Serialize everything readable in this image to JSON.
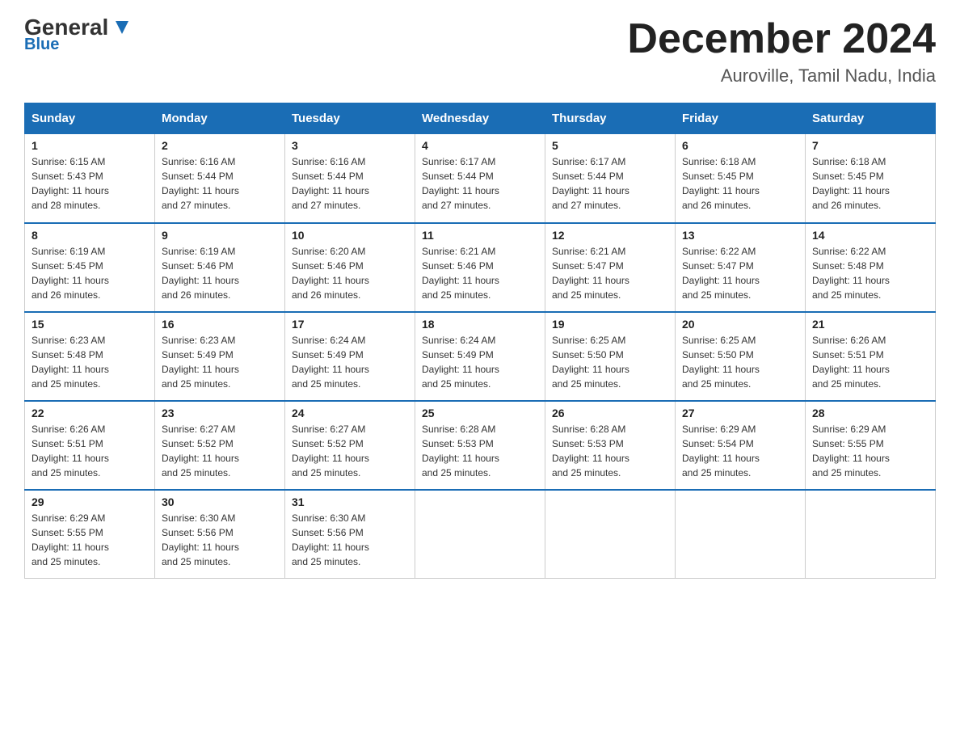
{
  "header": {
    "logo_general": "General",
    "logo_blue": "Blue",
    "month_title": "December 2024",
    "location": "Auroville, Tamil Nadu, India"
  },
  "days_of_week": [
    "Sunday",
    "Monday",
    "Tuesday",
    "Wednesday",
    "Thursday",
    "Friday",
    "Saturday"
  ],
  "weeks": [
    [
      {
        "num": "1",
        "sunrise": "6:15 AM",
        "sunset": "5:43 PM",
        "daylight": "11 hours and 28 minutes."
      },
      {
        "num": "2",
        "sunrise": "6:16 AM",
        "sunset": "5:44 PM",
        "daylight": "11 hours and 27 minutes."
      },
      {
        "num": "3",
        "sunrise": "6:16 AM",
        "sunset": "5:44 PM",
        "daylight": "11 hours and 27 minutes."
      },
      {
        "num": "4",
        "sunrise": "6:17 AM",
        "sunset": "5:44 PM",
        "daylight": "11 hours and 27 minutes."
      },
      {
        "num": "5",
        "sunrise": "6:17 AM",
        "sunset": "5:44 PM",
        "daylight": "11 hours and 27 minutes."
      },
      {
        "num": "6",
        "sunrise": "6:18 AM",
        "sunset": "5:45 PM",
        "daylight": "11 hours and 26 minutes."
      },
      {
        "num": "7",
        "sunrise": "6:18 AM",
        "sunset": "5:45 PM",
        "daylight": "11 hours and 26 minutes."
      }
    ],
    [
      {
        "num": "8",
        "sunrise": "6:19 AM",
        "sunset": "5:45 PM",
        "daylight": "11 hours and 26 minutes."
      },
      {
        "num": "9",
        "sunrise": "6:19 AM",
        "sunset": "5:46 PM",
        "daylight": "11 hours and 26 minutes."
      },
      {
        "num": "10",
        "sunrise": "6:20 AM",
        "sunset": "5:46 PM",
        "daylight": "11 hours and 26 minutes."
      },
      {
        "num": "11",
        "sunrise": "6:21 AM",
        "sunset": "5:46 PM",
        "daylight": "11 hours and 25 minutes."
      },
      {
        "num": "12",
        "sunrise": "6:21 AM",
        "sunset": "5:47 PM",
        "daylight": "11 hours and 25 minutes."
      },
      {
        "num": "13",
        "sunrise": "6:22 AM",
        "sunset": "5:47 PM",
        "daylight": "11 hours and 25 minutes."
      },
      {
        "num": "14",
        "sunrise": "6:22 AM",
        "sunset": "5:48 PM",
        "daylight": "11 hours and 25 minutes."
      }
    ],
    [
      {
        "num": "15",
        "sunrise": "6:23 AM",
        "sunset": "5:48 PM",
        "daylight": "11 hours and 25 minutes."
      },
      {
        "num": "16",
        "sunrise": "6:23 AM",
        "sunset": "5:49 PM",
        "daylight": "11 hours and 25 minutes."
      },
      {
        "num": "17",
        "sunrise": "6:24 AM",
        "sunset": "5:49 PM",
        "daylight": "11 hours and 25 minutes."
      },
      {
        "num": "18",
        "sunrise": "6:24 AM",
        "sunset": "5:49 PM",
        "daylight": "11 hours and 25 minutes."
      },
      {
        "num": "19",
        "sunrise": "6:25 AM",
        "sunset": "5:50 PM",
        "daylight": "11 hours and 25 minutes."
      },
      {
        "num": "20",
        "sunrise": "6:25 AM",
        "sunset": "5:50 PM",
        "daylight": "11 hours and 25 minutes."
      },
      {
        "num": "21",
        "sunrise": "6:26 AM",
        "sunset": "5:51 PM",
        "daylight": "11 hours and 25 minutes."
      }
    ],
    [
      {
        "num": "22",
        "sunrise": "6:26 AM",
        "sunset": "5:51 PM",
        "daylight": "11 hours and 25 minutes."
      },
      {
        "num": "23",
        "sunrise": "6:27 AM",
        "sunset": "5:52 PM",
        "daylight": "11 hours and 25 minutes."
      },
      {
        "num": "24",
        "sunrise": "6:27 AM",
        "sunset": "5:52 PM",
        "daylight": "11 hours and 25 minutes."
      },
      {
        "num": "25",
        "sunrise": "6:28 AM",
        "sunset": "5:53 PM",
        "daylight": "11 hours and 25 minutes."
      },
      {
        "num": "26",
        "sunrise": "6:28 AM",
        "sunset": "5:53 PM",
        "daylight": "11 hours and 25 minutes."
      },
      {
        "num": "27",
        "sunrise": "6:29 AM",
        "sunset": "5:54 PM",
        "daylight": "11 hours and 25 minutes."
      },
      {
        "num": "28",
        "sunrise": "6:29 AM",
        "sunset": "5:55 PM",
        "daylight": "11 hours and 25 minutes."
      }
    ],
    [
      {
        "num": "29",
        "sunrise": "6:29 AM",
        "sunset": "5:55 PM",
        "daylight": "11 hours and 25 minutes."
      },
      {
        "num": "30",
        "sunrise": "6:30 AM",
        "sunset": "5:56 PM",
        "daylight": "11 hours and 25 minutes."
      },
      {
        "num": "31",
        "sunrise": "6:30 AM",
        "sunset": "5:56 PM",
        "daylight": "11 hours and 25 minutes."
      },
      null,
      null,
      null,
      null
    ]
  ],
  "labels": {
    "sunrise": "Sunrise:",
    "sunset": "Sunset:",
    "daylight": "Daylight:"
  }
}
